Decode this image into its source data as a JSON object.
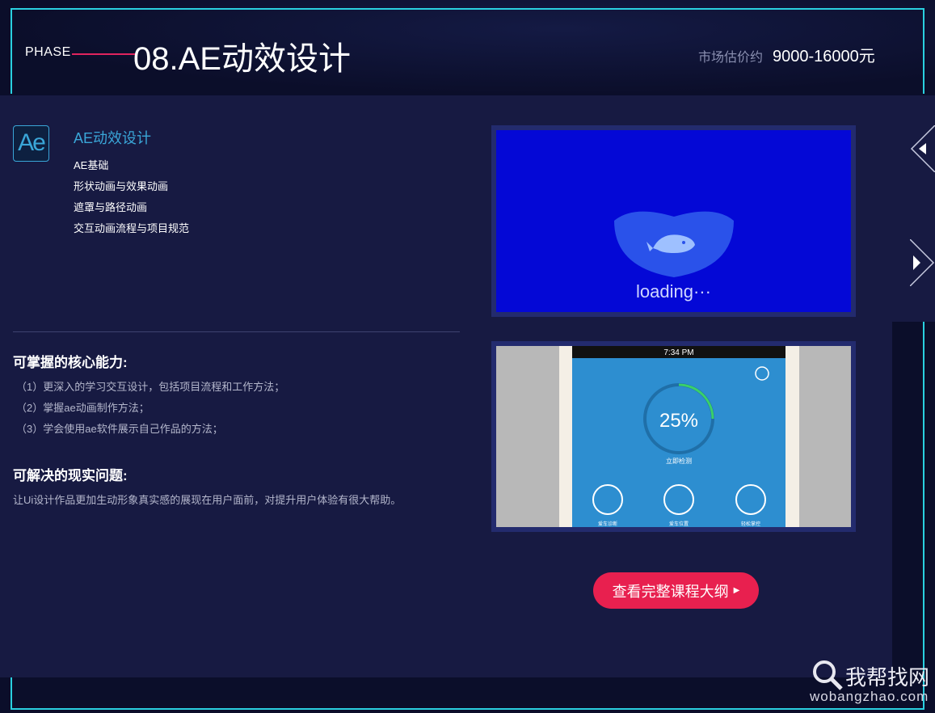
{
  "header": {
    "phase_label": "PHASE",
    "title": "08.AE动效设计",
    "price_label": "市场估价约",
    "price_value": "9000-16000元"
  },
  "course": {
    "icon_text": "Ae",
    "name": "AE动效设计",
    "topics": [
      "AE基础",
      "形状动画与效果动画",
      "遮罩与路径动画",
      "交互动画流程与项目规范"
    ]
  },
  "abilities": {
    "heading": "可掌握的核心能力:",
    "items": [
      "（1）更深入的学习交互设计，包括项目流程和工作方法；",
      "（2）掌握ae动画制作方法；",
      "（3）学会使用ae软件展示自己作品的方法；"
    ]
  },
  "problems": {
    "heading": "可解决的现实问题:",
    "text": "让Ui设计作品更加生动形象真实感的展现在用户面前，对提升用户体验有很大帮助。"
  },
  "preview1": {
    "loading_text": "loading···"
  },
  "preview2": {
    "time": "7:34 PM",
    "percent": "25%",
    "progress": 0.25,
    "check_label": "立即检测",
    "actions": [
      "爱车诊断",
      "爱车位置",
      "轻松掌控"
    ]
  },
  "cta": {
    "label": "查看完整课程大纲"
  },
  "watermark": {
    "text": "我帮找网",
    "sub": "wobangzhao.com"
  },
  "colors": {
    "accent": "#e8204f",
    "highlight": "#3aa6d8",
    "frame": "#2ad0e0",
    "panel": "#171a42"
  }
}
